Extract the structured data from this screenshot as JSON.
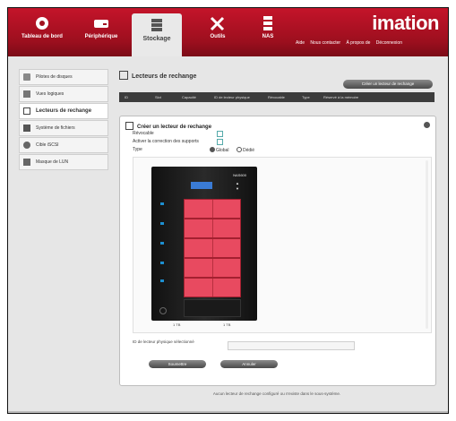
{
  "brand": "imation",
  "nav": [
    {
      "label": "Tableau de bord",
      "icon": "dashboard-icon"
    },
    {
      "label": "Périphérique",
      "icon": "drive-icon"
    },
    {
      "label": "Stockage",
      "icon": "storage-icon",
      "active": true
    },
    {
      "label": "Outils",
      "icon": "tools-icon"
    },
    {
      "label": "NAS",
      "icon": "nas-icon"
    }
  ],
  "toplinks": [
    "Aide",
    "Nous contacter",
    "À propos de",
    "Déconnexion"
  ],
  "sidebar": [
    {
      "label": "Pilotes de disques",
      "icon": "disk-icon"
    },
    {
      "label": "Vues logiques",
      "icon": "volume-icon"
    },
    {
      "label": "Lecteurs de rechange",
      "icon": "spare-icon",
      "active": true
    },
    {
      "label": "Système de fichiers",
      "icon": "folder-icon"
    },
    {
      "label": "Cible iSCSI",
      "icon": "network-icon"
    },
    {
      "label": "Masque de LUN",
      "icon": "lun-icon"
    }
  ],
  "page_title": "Lecteurs de rechange",
  "create_button": "Créer un lecteur de rechange",
  "columns": [
    "ID",
    "Slot",
    "Capacité",
    "ID de lecteur physique",
    "Révocable",
    "Type",
    "Réservé à la mémoire"
  ],
  "panel": {
    "title": "Créer un lecteur de rechange",
    "revocable_label": "Révocable",
    "media_label": "Activer la correction des supports",
    "type_label": "Type",
    "type_options": [
      "Global",
      "Dédié"
    ],
    "device_label": "NAS600",
    "bay_labels": [
      "1 TB",
      "1 TB"
    ],
    "selected_label": "ID de lecteur physique sélectionné",
    "submit_button": "Soumettre",
    "cancel_button": "Annuler"
  },
  "status_text": "Aucun lecteur de rechange configuré ou n'existe dans le sous-système."
}
